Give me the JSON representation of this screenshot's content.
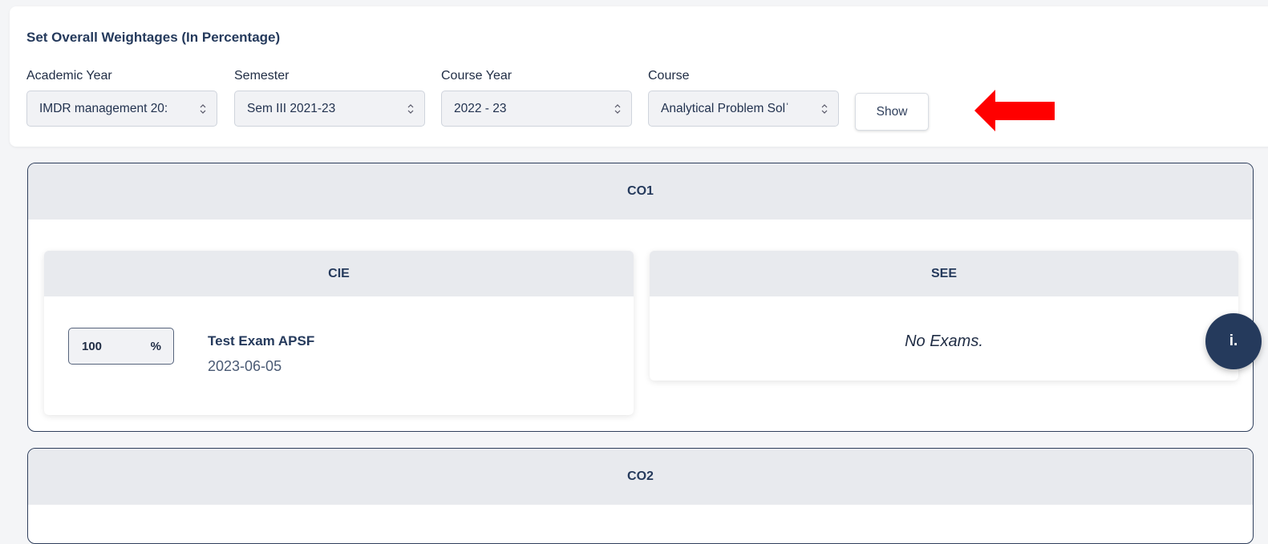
{
  "filters": {
    "title": "Set Overall Weightages (In Percentage)",
    "academic_year": {
      "label": "Academic Year",
      "value": "IMDR management 20:"
    },
    "semester": {
      "label": "Semester",
      "value": "Sem III 2021-23"
    },
    "course_year": {
      "label": "Course Year",
      "value": "2022 - 23"
    },
    "course": {
      "label": "Course",
      "value": "Analytical Problem Solˈ"
    },
    "show_label": "Show"
  },
  "colors": {
    "accent": "#253a5c",
    "arrow": "#ff0000",
    "panel_header": "#e8eaee"
  },
  "co_panels": [
    {
      "title": "CO1",
      "cie": {
        "title": "CIE",
        "exams": [
          {
            "weight": "100",
            "unit": "%",
            "name": "Test Exam APSF",
            "date": "2023-06-05"
          }
        ]
      },
      "see": {
        "title": "SEE",
        "empty_text": "No Exams."
      }
    },
    {
      "title": "CO2"
    }
  ],
  "info_button": {
    "label": "i."
  }
}
